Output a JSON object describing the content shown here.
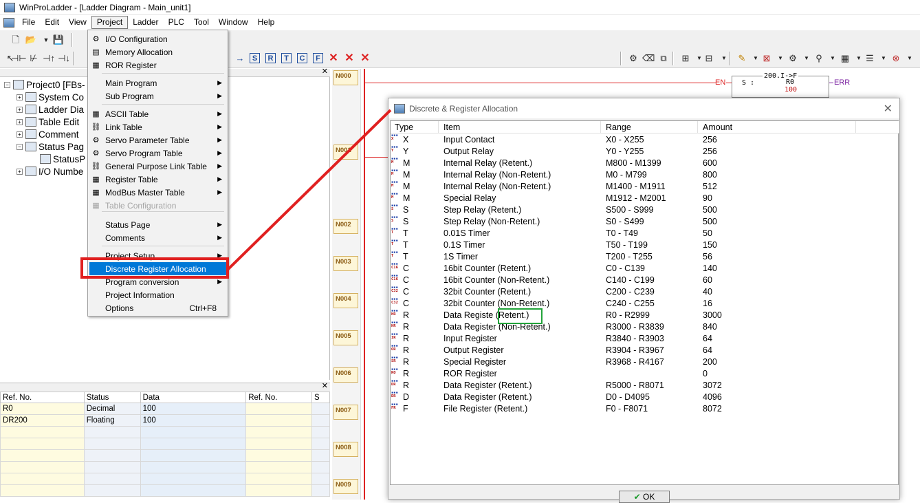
{
  "window": {
    "title": "WinProLadder - [Ladder Diagram - Main_unit1]"
  },
  "menubar": {
    "items": [
      "File",
      "Edit",
      "View",
      "Project",
      "Ladder",
      "PLC",
      "Tool",
      "Window",
      "Help"
    ],
    "active": "Project"
  },
  "project_menu": {
    "items": [
      {
        "label": "I/O Configuration",
        "icon": "io-config-icon",
        "submenu": false,
        "disabled": false
      },
      {
        "label": "Memory Allocation",
        "icon": "memory-icon",
        "submenu": false,
        "disabled": false
      },
      {
        "label": "ROR Register",
        "icon": "register-icon",
        "submenu": false,
        "disabled": false
      },
      {
        "label": "Main Program",
        "icon": "program-icon",
        "submenu": true,
        "disabled": false
      },
      {
        "label": "Sub Program",
        "icon": "program-icon",
        "submenu": true,
        "disabled": false
      },
      {
        "label": "ASCII Table",
        "icon": "table-icon",
        "submenu": true,
        "disabled": false
      },
      {
        "label": "Link Table",
        "icon": "link-icon",
        "submenu": true,
        "disabled": false
      },
      {
        "label": "Servo Parameter Table",
        "icon": "servo-icon",
        "submenu": true,
        "disabled": false
      },
      {
        "label": "Servo Program Table",
        "icon": "servo-icon",
        "submenu": true,
        "disabled": false
      },
      {
        "label": "General Purpose Link Table",
        "icon": "link-icon",
        "submenu": true,
        "disabled": false
      },
      {
        "label": "Register Table",
        "icon": "register-icon",
        "submenu": true,
        "disabled": false
      },
      {
        "label": "ModBus Master Table",
        "icon": "modbus-icon",
        "submenu": true,
        "disabled": false
      },
      {
        "label": "Table Configuration",
        "icon": "table-icon",
        "submenu": false,
        "disabled": true
      },
      {
        "label": "Status Page",
        "icon": "",
        "submenu": true,
        "disabled": false
      },
      {
        "label": "Comments",
        "icon": "",
        "submenu": true,
        "disabled": false
      },
      {
        "label": "Project Setup",
        "icon": "",
        "submenu": true,
        "disabled": false
      },
      {
        "label": "Discrete  Register Allocation",
        "icon": "",
        "submenu": false,
        "disabled": false,
        "selected": true
      },
      {
        "label": "Program conversion",
        "icon": "",
        "submenu": true,
        "disabled": false
      },
      {
        "label": "Project Information",
        "icon": "",
        "submenu": false,
        "disabled": false
      },
      {
        "label": "Options",
        "icon": "",
        "submenu": false,
        "disabled": false,
        "shortcut": "Ctrl+F8"
      }
    ]
  },
  "tree": {
    "root": "Project0 [FBs-",
    "items": [
      "System Co",
      "Ladder Dia",
      "Table Edit",
      "Comment",
      "Status Pag",
      "StatusP",
      "I/O Numbe"
    ]
  },
  "ref_table": {
    "headers": [
      "Ref. No.",
      "Status",
      "Data",
      "Ref. No.",
      "S"
    ],
    "rows": [
      {
        "ref": "R0",
        "status": "Decimal",
        "data": "100"
      },
      {
        "ref": "DR200",
        "status": "Floating",
        "data": "100"
      }
    ]
  },
  "ladder": {
    "rungs": [
      "N000",
      "N001",
      "N002",
      "N003",
      "N004",
      "N005",
      "N006",
      "N007",
      "N008",
      "N009"
    ],
    "function_block": {
      "header": "200.I->F",
      "s_label": "S :",
      "operand": "R0",
      "value": "100",
      "en": "EN",
      "err": "ERR"
    }
  },
  "dialog": {
    "title": "Discrete & Register Allocation",
    "headers": [
      "Type",
      "Item",
      "Range",
      "Amount"
    ],
    "rows": [
      {
        "type": "X",
        "item": "Input Contact",
        "range": "X0 - X255",
        "amount": "256",
        "icon": "X"
      },
      {
        "type": "Y",
        "item": "Output Relay",
        "range": "Y0 - Y255",
        "amount": "256",
        "icon": "Y"
      },
      {
        "type": "M",
        "item": "Internal Relay (Retent.)",
        "range": "M800 - M1399",
        "amount": "600",
        "icon": "M"
      },
      {
        "type": "M",
        "item": "Internal Relay (Non-Retent.)",
        "range": "M0 - M799",
        "amount": "800",
        "icon": "M"
      },
      {
        "type": "M",
        "item": "Internal Relay (Non-Retent.)",
        "range": "M1400 - M1911",
        "amount": "512",
        "icon": "M"
      },
      {
        "type": "M",
        "item": "Special Relay",
        "range": "M1912 - M2001",
        "amount": "90",
        "icon": "M"
      },
      {
        "type": "S",
        "item": "Step Relay (Retent.)",
        "range": "S500 - S999",
        "amount": "500",
        "icon": "S"
      },
      {
        "type": "S",
        "item": "Step Relay (Non-Retent.)",
        "range": "S0 - S499",
        "amount": "500",
        "icon": "S"
      },
      {
        "type": "T",
        "item": "0.01S Timer",
        "range": "T0 - T49",
        "amount": "50",
        "icon": "T"
      },
      {
        "type": "T",
        "item": "0.1S Timer",
        "range": "T50 - T199",
        "amount": "150",
        "icon": "T"
      },
      {
        "type": "T",
        "item": "1S Timer",
        "range": "T200 - T255",
        "amount": "56",
        "icon": "T"
      },
      {
        "type": "C",
        "item": "16bit Counter (Retent.)",
        "range": "C0 - C139",
        "amount": "140",
        "icon": "C16"
      },
      {
        "type": "C",
        "item": "16bit Counter (Non-Retent.)",
        "range": "C140 - C199",
        "amount": "60",
        "icon": "C16"
      },
      {
        "type": "C",
        "item": "32bit Counter (Retent.)",
        "range": "C200 - C239",
        "amount": "40",
        "icon": "C32"
      },
      {
        "type": "C",
        "item": "32bit Counter (Non-Retent.)",
        "range": "C240 - C255",
        "amount": "16",
        "icon": "C32"
      },
      {
        "type": "R",
        "item": "Data Registe  (Retent.)",
        "range": "R0 - R2999",
        "amount": "3000",
        "icon": "HR"
      },
      {
        "type": "R",
        "item": "Data Register (Non-Retent.)",
        "range": "R3000 - R3839",
        "amount": "840",
        "icon": "HR"
      },
      {
        "type": "R",
        "item": "Input Register",
        "range": "R3840 - R3903",
        "amount": "64",
        "icon": "IR"
      },
      {
        "type": "R",
        "item": "Output Register",
        "range": "R3904 - R3967",
        "amount": "64",
        "icon": "OR"
      },
      {
        "type": "R",
        "item": "Special Register",
        "range": "R3968 - R4167",
        "amount": "200",
        "icon": "SR"
      },
      {
        "type": "R",
        "item": "ROR Register",
        "range": "",
        "amount": "0",
        "icon": "RO"
      },
      {
        "type": "R",
        "item": "Data Register (Retent.)",
        "range": "R5000 - R8071",
        "amount": "3072",
        "icon": "DR"
      },
      {
        "type": "D",
        "item": "Data Register (Retent.)",
        "range": "D0 - D4095",
        "amount": "4096",
        "icon": "DR"
      },
      {
        "type": "F",
        "item": "File Register (Retent.)",
        "range": "F0 - F8071",
        "amount": "8072",
        "icon": "FR"
      }
    ],
    "ok_label": "OK"
  },
  "colors": {
    "selection": "#0078d7",
    "annotation_red": "#e02020",
    "annotation_green": "#22a33a",
    "ladder_rail": "#dd2222"
  }
}
